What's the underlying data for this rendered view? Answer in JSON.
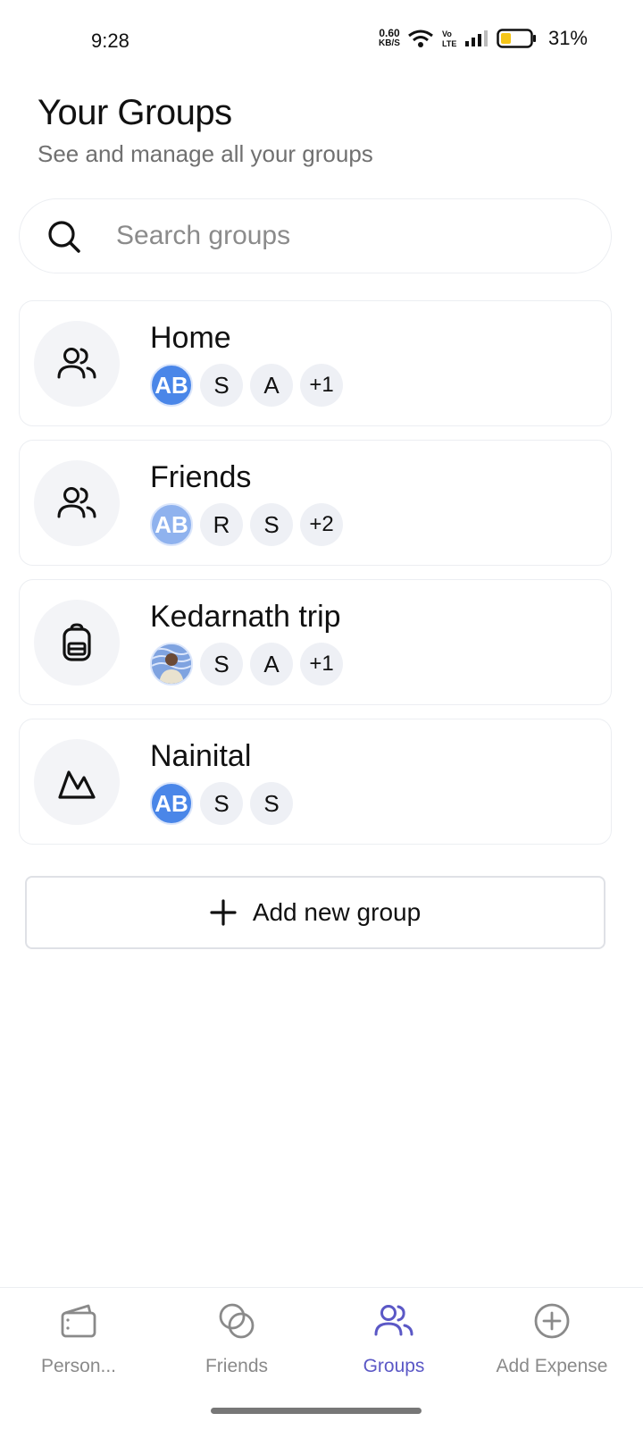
{
  "status_bar": {
    "time": "9:28",
    "net_speed_value": "0.60",
    "net_speed_unit": "KB/S",
    "battery_percent": "31%"
  },
  "header": {
    "title": "Your Groups",
    "subtitle": "See and manage all your groups"
  },
  "search": {
    "placeholder": "Search groups",
    "value": ""
  },
  "groups": [
    {
      "name": "Home",
      "icon": "users-icon",
      "members": [
        "AB",
        "S",
        "A",
        "+1"
      ]
    },
    {
      "name": "Friends",
      "icon": "users-icon",
      "members": [
        "AB",
        "R",
        "S",
        "+2"
      ]
    },
    {
      "name": "Kedarnath trip",
      "icon": "backpack-icon",
      "members": [
        "photo",
        "S",
        "A",
        "+1"
      ]
    },
    {
      "name": "Nainital",
      "icon": "mountain-icon",
      "members": [
        "AB",
        "S",
        "S"
      ]
    }
  ],
  "add_group_label": "Add new group",
  "bottom_nav": {
    "items": [
      {
        "label": "Person...",
        "icon": "wallet-icon",
        "active": false
      },
      {
        "label": "Friends",
        "icon": "overlapping-circles-icon",
        "active": false
      },
      {
        "label": "Groups",
        "icon": "users-icon",
        "active": true
      },
      {
        "label": "Add Expense",
        "icon": "plus-circle-icon",
        "active": false
      }
    ]
  },
  "colors": {
    "accent": "#5b58c6",
    "avatar_blue": "#4a86e8",
    "muted_text": "#707070"
  }
}
